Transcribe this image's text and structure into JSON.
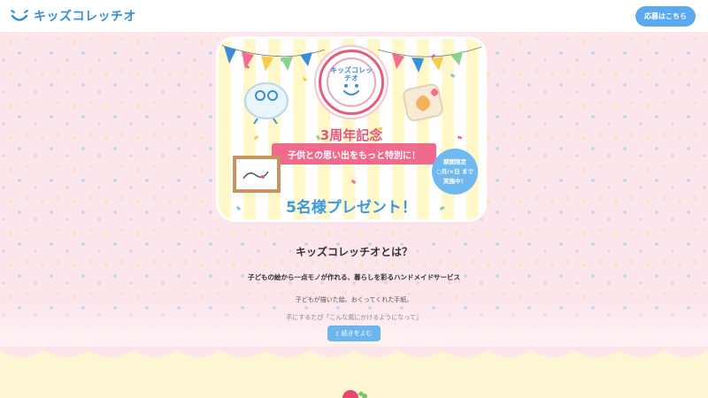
{
  "header": {
    "logo_text": "キッズコレッチオ",
    "apply_label": "応募はこちら"
  },
  "hero": {
    "stamp_text": "キッズコレッチオ",
    "anniversary": "3周年記念",
    "ribbon": "子供との思い出をもっと特別に！",
    "limited_line1": "期間限定",
    "limited_line2": "○月/×日 まで",
    "limited_line3": "実施中！",
    "gift": "5名様プレゼント！"
  },
  "about": {
    "title": "キッズコレッチオとは？",
    "lead": "子どもの絵から一点モノが作れる、暮らしを彩るハンドメイドサービス",
    "p1": "子どもが描いた絵、おくってくれた手紙。",
    "p2": "手にするたび「こんな風にかけるようになって」",
    "more_label": "続きをよむ"
  },
  "colors": {
    "brand_blue": "#3a8ed8",
    "button_blue": "#5aa9f0",
    "pink": "#ef6a8c",
    "background_pink": "#fce6ec",
    "cream": "#fdf6d3"
  }
}
